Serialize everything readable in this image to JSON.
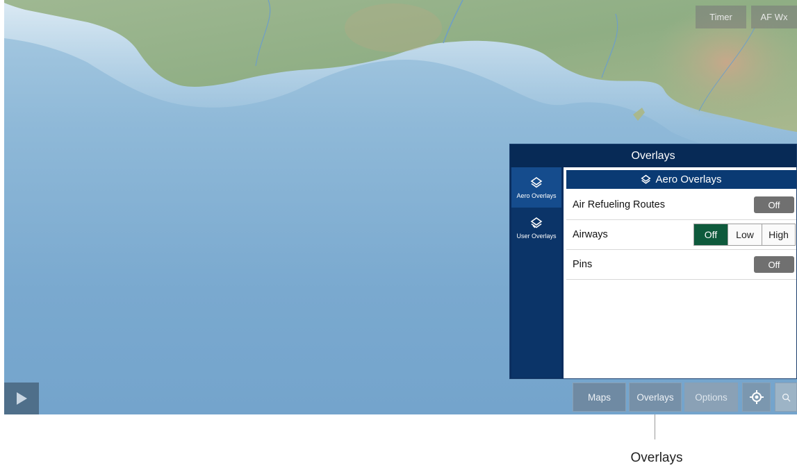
{
  "map": {
    "top_buttons": {
      "timer": "Timer",
      "af_wx": "AF Wx"
    }
  },
  "overlays_panel": {
    "title": "Overlays",
    "sidebar": [
      {
        "label": "Aero Overlays",
        "icon": "layers-icon",
        "active": true
      },
      {
        "label": "User Overlays",
        "icon": "user-layers-icon",
        "active": false
      }
    ],
    "section_header": "Aero Overlays",
    "rows": [
      {
        "label": "Air Refueling Routes",
        "toggle": "Off"
      },
      {
        "label": "Airways",
        "options": [
          "Off",
          "Low",
          "High"
        ],
        "selected": "Off"
      },
      {
        "label": "Pins",
        "toggle": "Off"
      }
    ]
  },
  "toolbar": {
    "maps": "Maps",
    "overlays": "Overlays",
    "options": "Options",
    "locate_icon": "locate-icon",
    "search_icon": "search-icon",
    "play_icon": "play-icon"
  },
  "callout": {
    "label": "Overlays"
  },
  "colors": {
    "panel_bg": "#0a2d5e",
    "active_segment": "#0e5a3c",
    "toggle_off": "#707070"
  }
}
